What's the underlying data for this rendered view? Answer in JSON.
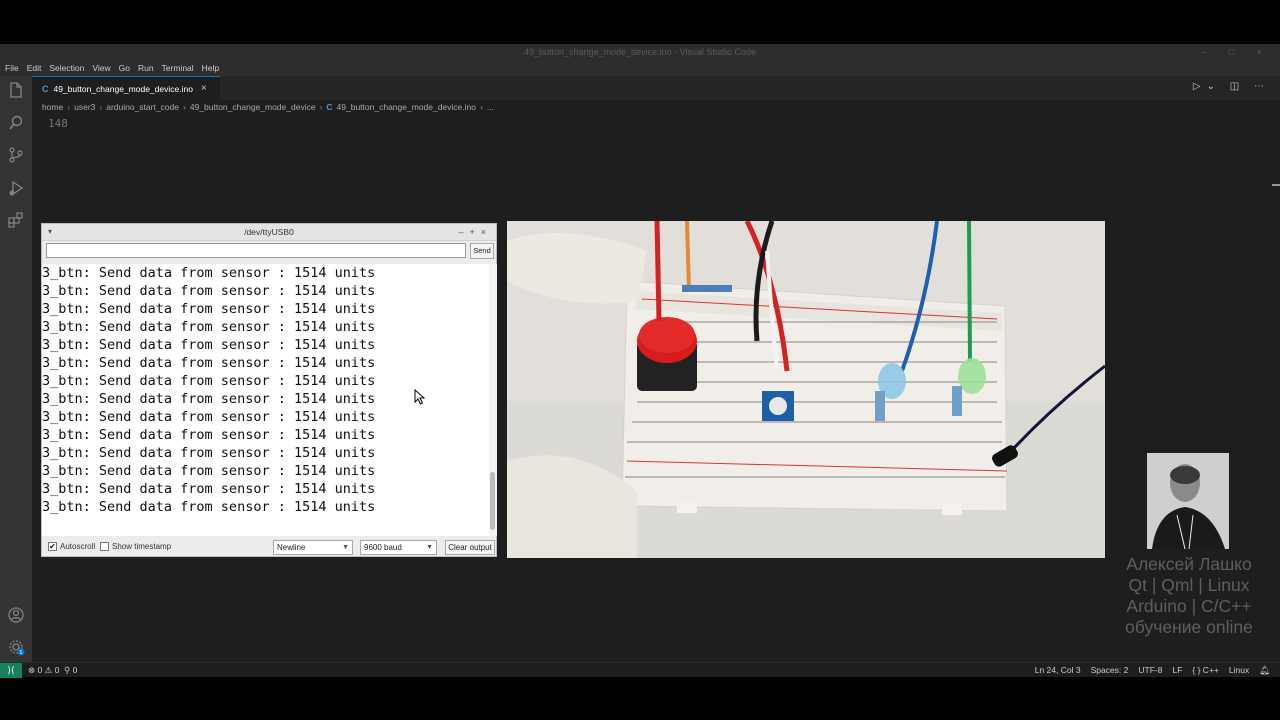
{
  "window": {
    "title": "49_button_change_mode_device.ino - Visual Studio Code"
  },
  "menu": [
    "File",
    "Edit",
    "Selection",
    "View",
    "Go",
    "Run",
    "Terminal",
    "Help"
  ],
  "tab": {
    "icon": "C",
    "label": "49_button_change_mode_device.ino",
    "close": "×"
  },
  "breadcrumb": {
    "items": [
      "home",
      "user3",
      "arduino_start_code",
      "49_button_change_mode_device"
    ],
    "file": "49_button_change_mode_device.ino",
    "tail": "..."
  },
  "editor": {
    "line_number": "148"
  },
  "serial": {
    "title": "/dev/ttyUSB0",
    "send_label": "Send",
    "lines": [
      "3_btn: Send data from sensor : 1514 units",
      "3_btn: Send data from sensor : 1514 units",
      "3_btn: Send data from sensor : 1514 units",
      "3_btn: Send data from sensor : 1514 units",
      "3_btn: Send data from sensor : 1514 units",
      "3_btn: Send data from sensor : 1514 units",
      "3_btn: Send data from sensor : 1514 units",
      "3_btn: Send data from sensor : 1514 units",
      "3_btn: Send data from sensor : 1514 units",
      "3_btn: Send data from sensor : 1514 units",
      "3_btn: Send data from sensor : 1514 units",
      "3_btn: Send data from sensor : 1514 units",
      "3_btn: Send data from sensor : 1514 units",
      "3_btn: Send data from sensor : 1514 units"
    ],
    "autoscroll_label": "Autoscroll",
    "autoscroll_checked": true,
    "timestamp_label": "Show timestamp",
    "timestamp_checked": false,
    "line_ending": "Newline",
    "baud": "9600 baud",
    "clear_label": "Clear output"
  },
  "status": {
    "errors": "0",
    "warnings": "0",
    "ports": "0",
    "position": "Ln 24, Col 3",
    "spaces": "Spaces: 2",
    "encoding": "UTF-8",
    "eol": "LF",
    "language": "{ } C++",
    "platform": "Linux",
    "settings_badge": "1"
  },
  "branding": [
    "Алексей Лашко",
    "Qt | Qml | Linux",
    "Arduino | C/C++",
    "обучение online"
  ],
  "colors": {
    "accent": "#007acc",
    "remote": "#16825d"
  }
}
